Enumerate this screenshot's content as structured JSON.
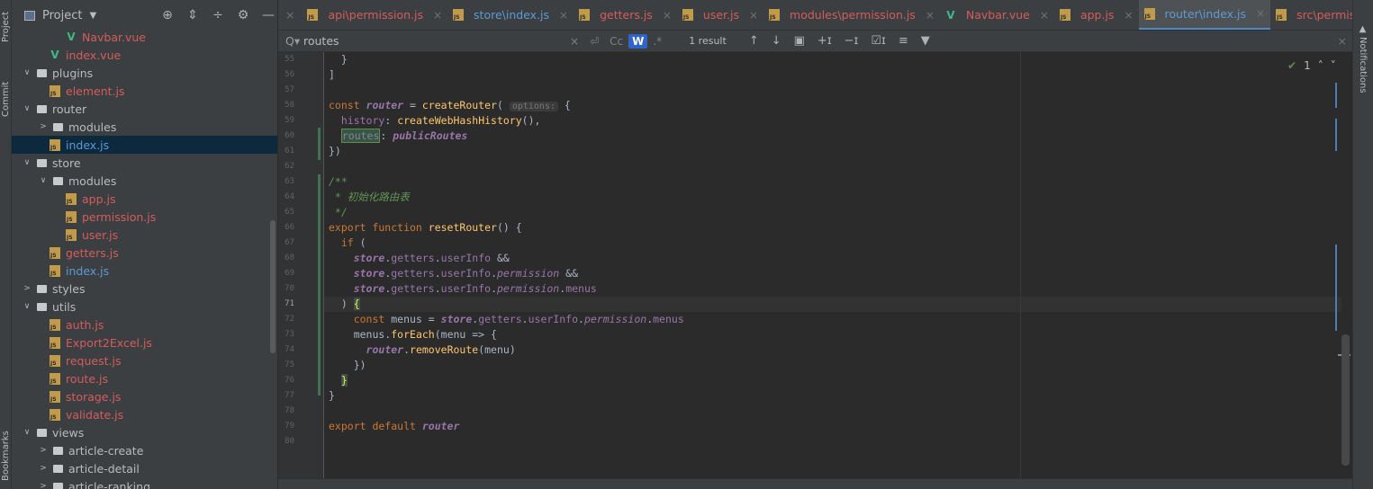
{
  "left_strip": {
    "project": "Project",
    "commit": "Commit",
    "bookmarks": "Bookmarks"
  },
  "project_panel": {
    "title": "Project"
  },
  "tree": [
    {
      "label": "Navbar.vue",
      "type": "vue",
      "indent": 3,
      "color": "red"
    },
    {
      "label": "index.vue",
      "type": "vue",
      "indent": 2,
      "color": "red"
    },
    {
      "label": "plugins",
      "type": "folder",
      "indent": 1,
      "open": true
    },
    {
      "label": "element.js",
      "type": "js",
      "indent": 2,
      "color": "red"
    },
    {
      "label": "router",
      "type": "folder",
      "indent": 1,
      "open": true
    },
    {
      "label": "modules",
      "type": "folder",
      "indent": 2,
      "open": false
    },
    {
      "label": "index.js",
      "type": "js",
      "indent": 2,
      "color": "blue",
      "selected": true
    },
    {
      "label": "store",
      "type": "folder",
      "indent": 1,
      "open": true
    },
    {
      "label": "modules",
      "type": "folder",
      "indent": 2,
      "open": true
    },
    {
      "label": "app.js",
      "type": "js",
      "indent": 3,
      "color": "red"
    },
    {
      "label": "permission.js",
      "type": "js",
      "indent": 3,
      "color": "red"
    },
    {
      "label": "user.js",
      "type": "js",
      "indent": 3,
      "color": "red"
    },
    {
      "label": "getters.js",
      "type": "js",
      "indent": 2,
      "color": "red"
    },
    {
      "label": "index.js",
      "type": "js",
      "indent": 2,
      "color": "blue"
    },
    {
      "label": "styles",
      "type": "folder",
      "indent": 1,
      "open": false
    },
    {
      "label": "utils",
      "type": "folder",
      "indent": 1,
      "open": true
    },
    {
      "label": "auth.js",
      "type": "js",
      "indent": 2,
      "color": "red"
    },
    {
      "label": "Export2Excel.js",
      "type": "js",
      "indent": 2,
      "color": "red"
    },
    {
      "label": "request.js",
      "type": "js",
      "indent": 2,
      "color": "red"
    },
    {
      "label": "route.js",
      "type": "js",
      "indent": 2,
      "color": "red"
    },
    {
      "label": "storage.js",
      "type": "js",
      "indent": 2,
      "color": "red"
    },
    {
      "label": "validate.js",
      "type": "js",
      "indent": 2,
      "color": "red"
    },
    {
      "label": "views",
      "type": "folder",
      "indent": 1,
      "open": true
    },
    {
      "label": "article-create",
      "type": "folder",
      "indent": 2,
      "open": false
    },
    {
      "label": "article-detail",
      "type": "folder",
      "indent": 2,
      "open": false
    },
    {
      "label": "article-ranking",
      "type": "folder",
      "indent": 2,
      "open": false
    }
  ],
  "tabs": [
    {
      "label": "api\\permission.js",
      "type": "js",
      "blue": false,
      "active": false
    },
    {
      "label": "store\\index.js",
      "type": "js",
      "blue": true,
      "active": false
    },
    {
      "label": "getters.js",
      "type": "js",
      "blue": false,
      "active": false
    },
    {
      "label": "user.js",
      "type": "js",
      "blue": false,
      "active": false
    },
    {
      "label": "modules\\permission.js",
      "type": "js",
      "blue": false,
      "active": false
    },
    {
      "label": "Navbar.vue",
      "type": "vue",
      "blue": false,
      "active": false
    },
    {
      "label": "app.js",
      "type": "js",
      "blue": false,
      "active": false
    },
    {
      "label": "router\\index.js",
      "type": "js",
      "blue": true,
      "active": true
    },
    {
      "label": "src\\permission.js",
      "type": "js",
      "blue": false,
      "active": false
    }
  ],
  "search": {
    "query": "routes",
    "results": "1 result",
    "case_label": "Cc",
    "words_label": "W",
    "regex_label": ".*"
  },
  "editor": {
    "line_numbers": [
      "55",
      "56",
      "57",
      "58",
      "59",
      "60",
      "61",
      "62",
      "63",
      "64",
      "65",
      "66",
      "67",
      "68",
      "69",
      "70",
      "71",
      "72",
      "73",
      "74",
      "75",
      "76",
      "77",
      "78",
      "79",
      "80"
    ],
    "current_line": "71",
    "inspection": {
      "count": "1"
    },
    "hint_options": "options:",
    "comment_line": " * 初始化路由表"
  },
  "right_strip": {
    "notifications": "Notifications"
  },
  "icons": {
    "project": "window-icon",
    "settings": "gear-icon",
    "search": "search-icon"
  }
}
